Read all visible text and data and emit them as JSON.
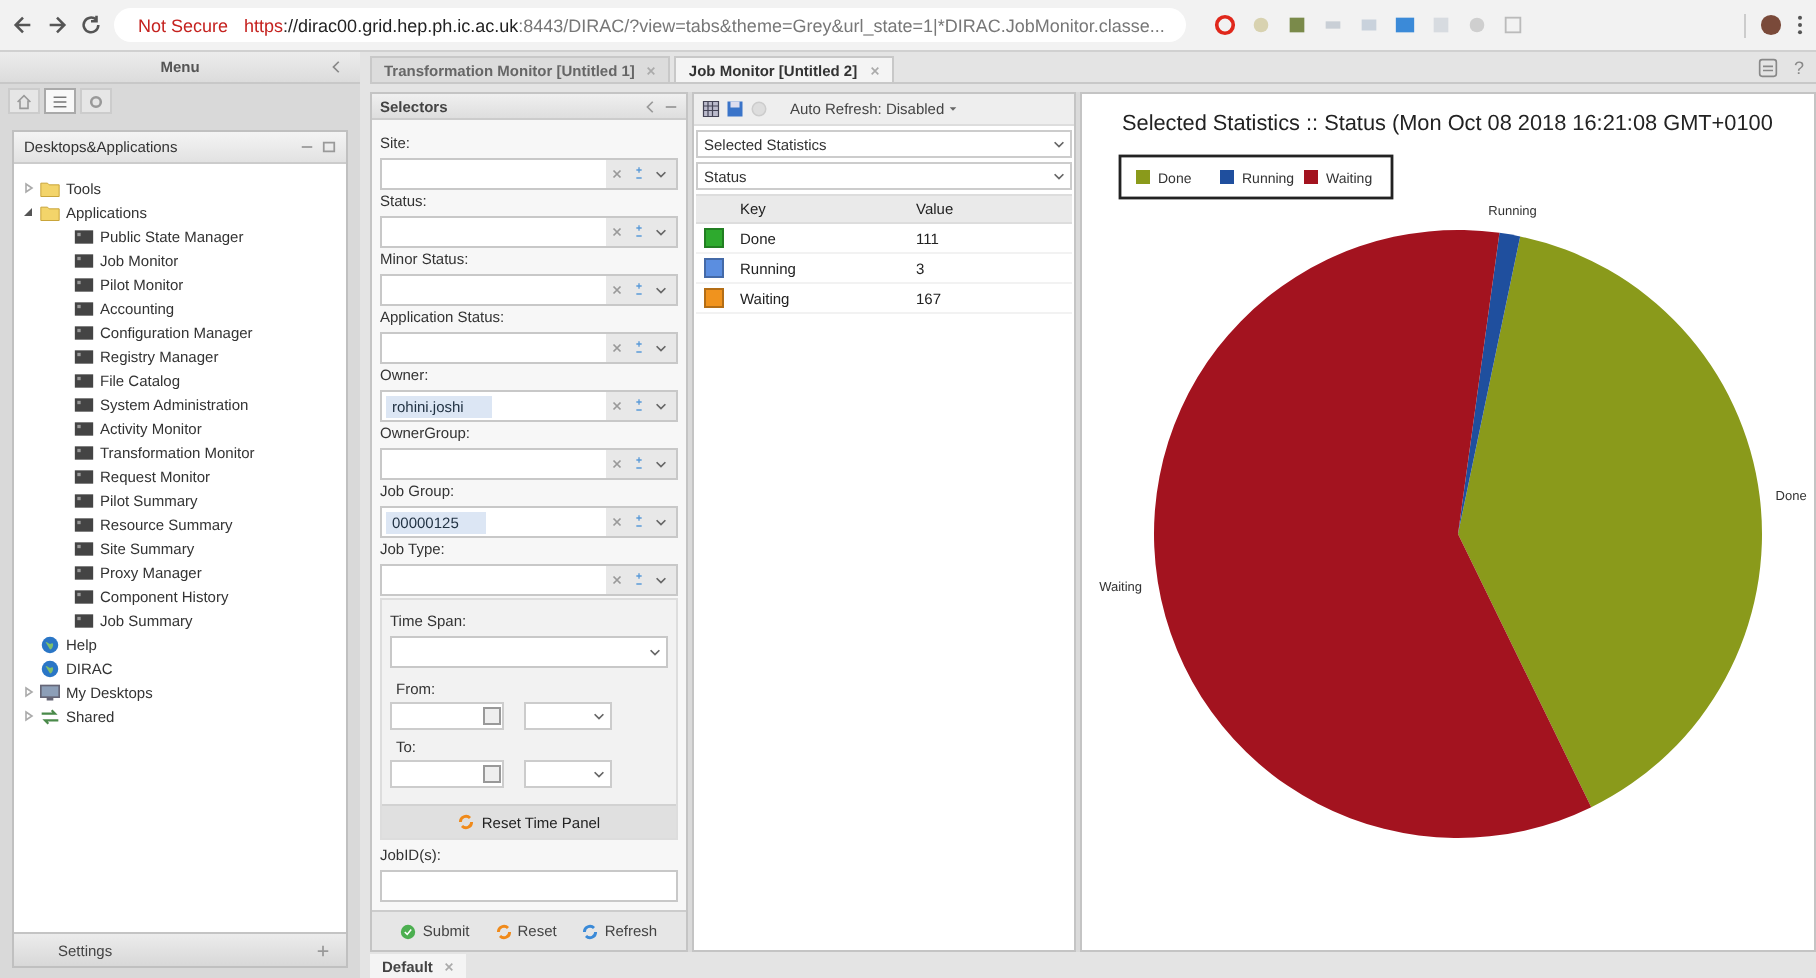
{
  "browser": {
    "security": "Not Secure",
    "url": {
      "scheme": "https",
      "host": "://dirac00.grid.hep.ph.ic.ac.uk",
      "rest": ":8443/DIRAC/?view=tabs&theme=Grey&url_state=1|*DIRAC.JobMonitor.classe..."
    }
  },
  "menu": {
    "title": "Menu",
    "views": [
      {
        "kind": "home",
        "selected": false
      },
      {
        "kind": "list",
        "selected": true
      },
      {
        "kind": "gear",
        "selected": false
      }
    ],
    "tree_title": "Desktops&Applications",
    "tree": [
      {
        "label": "Tools",
        "kind": "folder",
        "expanded": false
      },
      {
        "label": "Applications",
        "kind": "folder",
        "expanded": true,
        "children": [
          {
            "label": "Public State Manager",
            "kind": "app"
          },
          {
            "label": "Job Monitor",
            "kind": "app"
          },
          {
            "label": "Pilot Monitor",
            "kind": "app"
          },
          {
            "label": "Accounting",
            "kind": "app"
          },
          {
            "label": "Configuration Manager",
            "kind": "app"
          },
          {
            "label": "Registry Manager",
            "kind": "app"
          },
          {
            "label": "File Catalog",
            "kind": "app"
          },
          {
            "label": "System Administration",
            "kind": "app"
          },
          {
            "label": "Activity Monitor",
            "kind": "app"
          },
          {
            "label": "Transformation Monitor",
            "kind": "app"
          },
          {
            "label": "Request Monitor",
            "kind": "app"
          },
          {
            "label": "Pilot Summary",
            "kind": "app"
          },
          {
            "label": "Resource Summary",
            "kind": "app"
          },
          {
            "label": "Site Summary",
            "kind": "app"
          },
          {
            "label": "Proxy Manager",
            "kind": "app"
          },
          {
            "label": "Component History",
            "kind": "app"
          },
          {
            "label": "Job Summary",
            "kind": "app"
          }
        ]
      },
      {
        "label": "Help",
        "kind": "link"
      },
      {
        "label": "DIRAC",
        "kind": "link"
      },
      {
        "label": "My Desktops",
        "kind": "desktops",
        "expanded": false
      },
      {
        "label": "Shared",
        "kind": "shared",
        "expanded": false
      }
    ],
    "footer": "Settings"
  },
  "tabs": [
    {
      "label": "Transformation Monitor [Untitled 1]",
      "selected": false
    },
    {
      "label": "Job Monitor [Untitled 2]",
      "selected": true
    }
  ],
  "help": "?",
  "selectors": {
    "title": "Selectors",
    "fields": [
      {
        "label": "Site:"
      },
      {
        "label": "Status:"
      },
      {
        "label": "Minor Status:"
      },
      {
        "label": "Application Status:"
      },
      {
        "label": "Owner:",
        "value": "rohini.joshi"
      },
      {
        "label": "OwnerGroup:"
      },
      {
        "label": "Job Group:",
        "value": "00000125"
      },
      {
        "label": "Job Type:"
      }
    ],
    "time": {
      "label": "Time Span:",
      "from": "From:",
      "to": "To:",
      "reset": "Reset Time Panel"
    },
    "jobid": {
      "label": "JobID(s):"
    },
    "buttons": [
      {
        "label": "Submit",
        "kind": "submit"
      },
      {
        "label": "Reset",
        "kind": "reset"
      },
      {
        "label": "Refresh",
        "kind": "refresh"
      }
    ]
  },
  "statistics": {
    "auto_refresh": "Auto Refresh: Disabled",
    "combos": [
      "Selected Statistics",
      "Status"
    ],
    "columns": [
      "Key",
      "Value"
    ],
    "rows": [
      {
        "key": "Done",
        "value": "111",
        "color": "#2eaa2e"
      },
      {
        "key": "Running",
        "value": "3",
        "color": "#5b8ee0"
      },
      {
        "key": "Waiting",
        "value": "167",
        "color": "#f0931e"
      }
    ]
  },
  "chart": {
    "legend": [
      {
        "label": "Done",
        "color": "#8a9a1b"
      },
      {
        "label": "Running",
        "color": "#1f4f9e"
      },
      {
        "label": "Waiting",
        "color": "#a3131f"
      }
    ],
    "chart_data": {
      "type": "pie",
      "title": "Selected Statistics :: Status (Mon Oct 08 2018 16:21:08 GMT+0100",
      "categories": [
        "Done",
        "Running",
        "Waiting"
      ],
      "series": [
        {
          "values": [
            39.5,
            1.1,
            59.4
          ]
        }
      ]
    }
  },
  "bottom_tabs": [
    {
      "label": "Default",
      "selected": true
    }
  ]
}
